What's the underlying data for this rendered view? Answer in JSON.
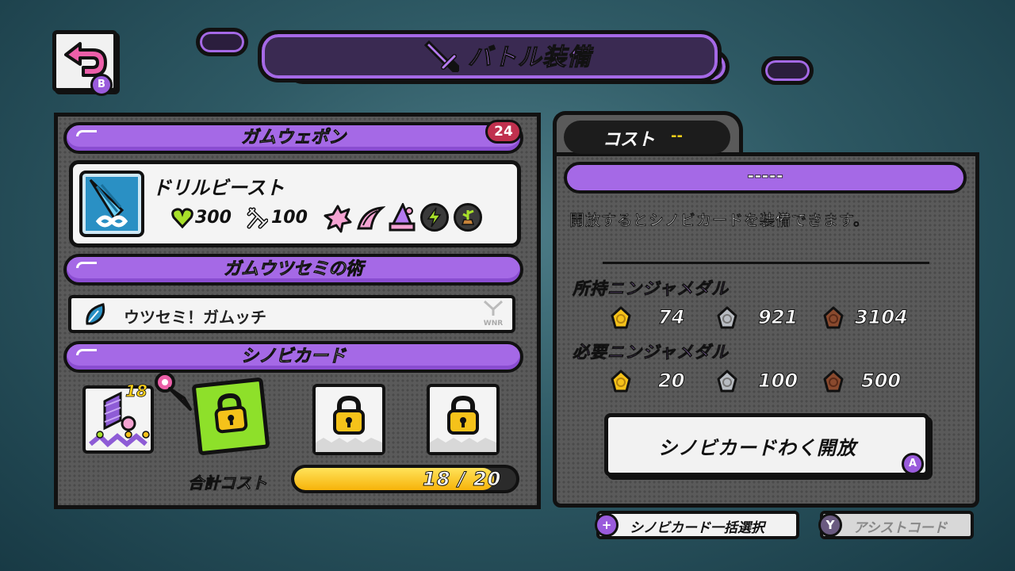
{
  "header": {
    "title": "バトル装備",
    "back_button_key": "B"
  },
  "left_panel": {
    "weapon_section_label": "ガムウェポン",
    "weapon_count": "24",
    "weapon": {
      "name": "ドリルビースト",
      "hp": "300",
      "attack": "100",
      "icons": [
        "splat-icon",
        "slash-icon",
        "witch-hat-icon",
        "lightning-icon",
        "sprout-icon"
      ]
    },
    "utsusemi_section_label": "ガムウツセミの術",
    "utsusemi": {
      "name": "ウツセミ！ガムッチ",
      "badge": "WNR"
    },
    "cards_section_label": "シノビカード",
    "cards": {
      "first_card_cost": "18",
      "slots": [
        "equipped",
        "unlocked-empty",
        "locked",
        "locked"
      ]
    },
    "total_cost": {
      "label": "合計コスト",
      "text": "18 / 20",
      "current": 18,
      "max": 20
    }
  },
  "right_panel": {
    "cost_label": "コスト",
    "cost_value": "--",
    "card_name": "-----",
    "description": "開放するとシノビカードを装備できます。",
    "owned_label": "所持ニンジャメダル",
    "owned": {
      "gold": "74",
      "silver": "921",
      "bronze": "3104"
    },
    "required_label": "必要ニンジャメダル",
    "required": {
      "gold": "20",
      "silver": "100",
      "bronze": "500"
    },
    "unlock_button": "シノビカードわく開放",
    "unlock_button_key": "A"
  },
  "footer": {
    "select_all_key": "+",
    "select_all_label": "シノビカード一括選択",
    "assist_key": "Y",
    "assist_label": "アシストコード"
  },
  "colors": {
    "accent_purple": "#a569e6",
    "panel_gray": "#5a5a5a",
    "gold": "#f5c21a",
    "silver": "#b8bcc2",
    "bronze": "#8a4a2e"
  }
}
